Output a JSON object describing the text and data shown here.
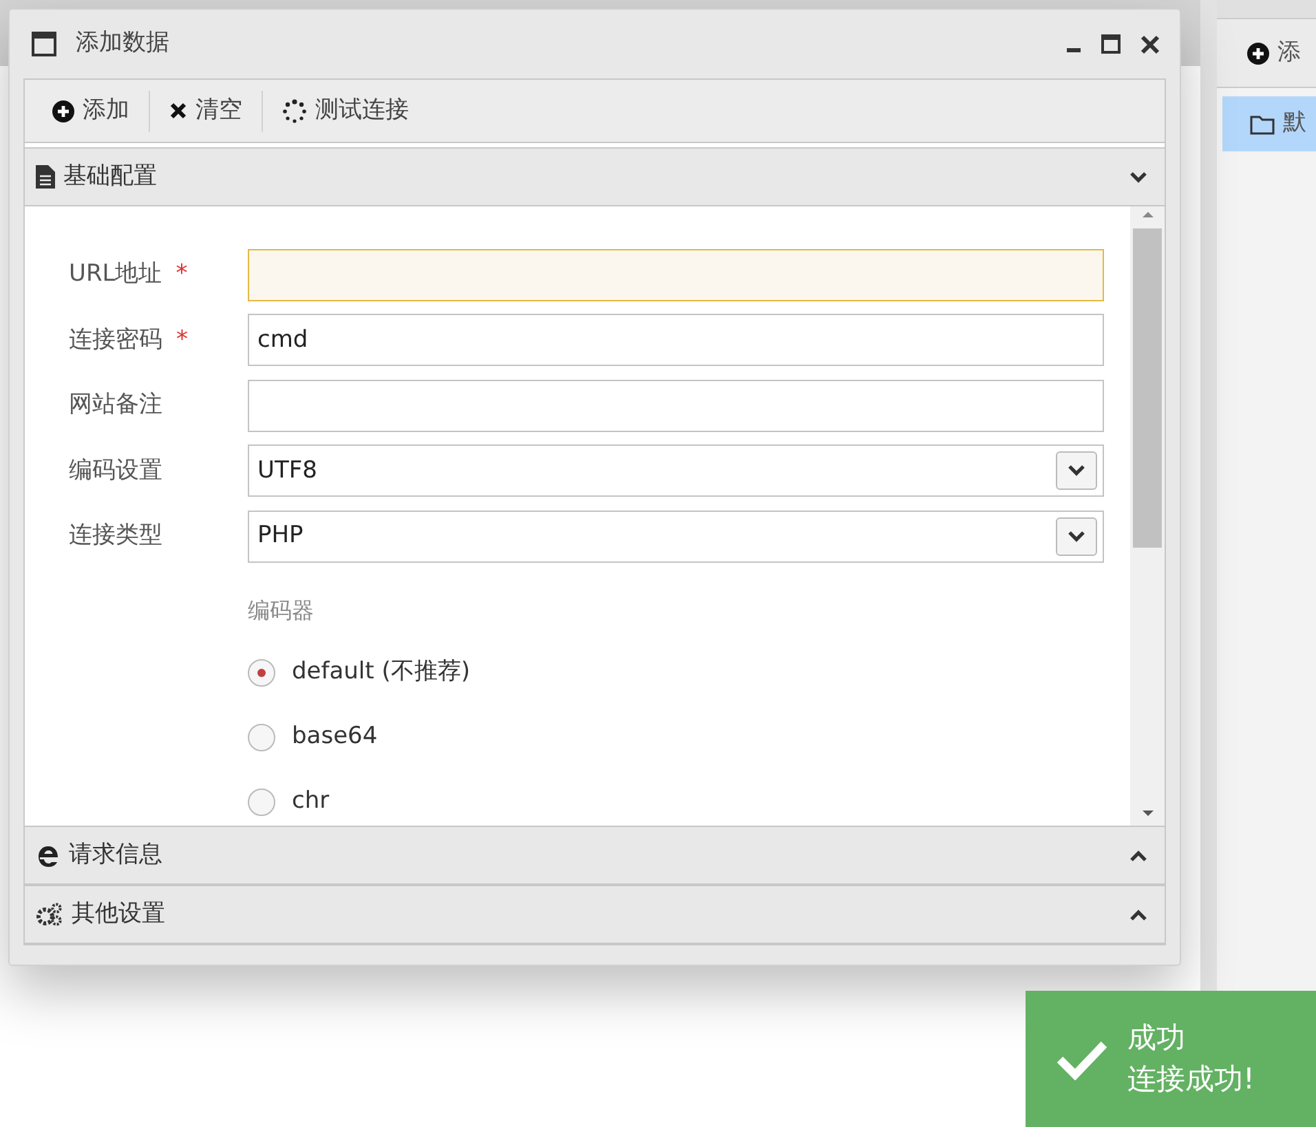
{
  "window": {
    "title": "添加数据"
  },
  "toolbar": [
    {
      "label": "添加",
      "kind": "add"
    },
    {
      "label": "清空",
      "kind": "clear"
    },
    {
      "label": "测试连接",
      "kind": "test"
    }
  ],
  "sections": [
    {
      "title": "基础配置",
      "kind": "doc",
      "expanded": true
    },
    {
      "title": "请求信息",
      "kind": "ie",
      "expanded": false
    },
    {
      "title": "其他设置",
      "kind": "gears",
      "expanded": false
    }
  ],
  "fields": [
    {
      "label": "URL地址",
      "required_mark": "*",
      "kind": "text",
      "focused": true
    },
    {
      "label": "连接密码",
      "required_mark": "*",
      "kind": "text",
      "value": "cmd",
      "focused": false
    },
    {
      "label": "网站备注",
      "kind": "text",
      "focused": false
    },
    {
      "label": "编码设置",
      "kind": "select",
      "value": "UTF8",
      "focused": false
    },
    {
      "label": "连接类型",
      "kind": "select",
      "value": "PHP",
      "focused": false
    }
  ],
  "encoder": {
    "label": "编码器",
    "options": [
      {
        "label": "default (不推荐)",
        "selected": true
      },
      {
        "label": "base64",
        "selected": false
      },
      {
        "label": "chr",
        "selected": false
      }
    ]
  },
  "side_panel": {
    "button": "添",
    "items": [
      {
        "label": "默",
        "selected": true
      }
    ]
  },
  "toast": {
    "title": "成功",
    "message": "连接成功!"
  }
}
